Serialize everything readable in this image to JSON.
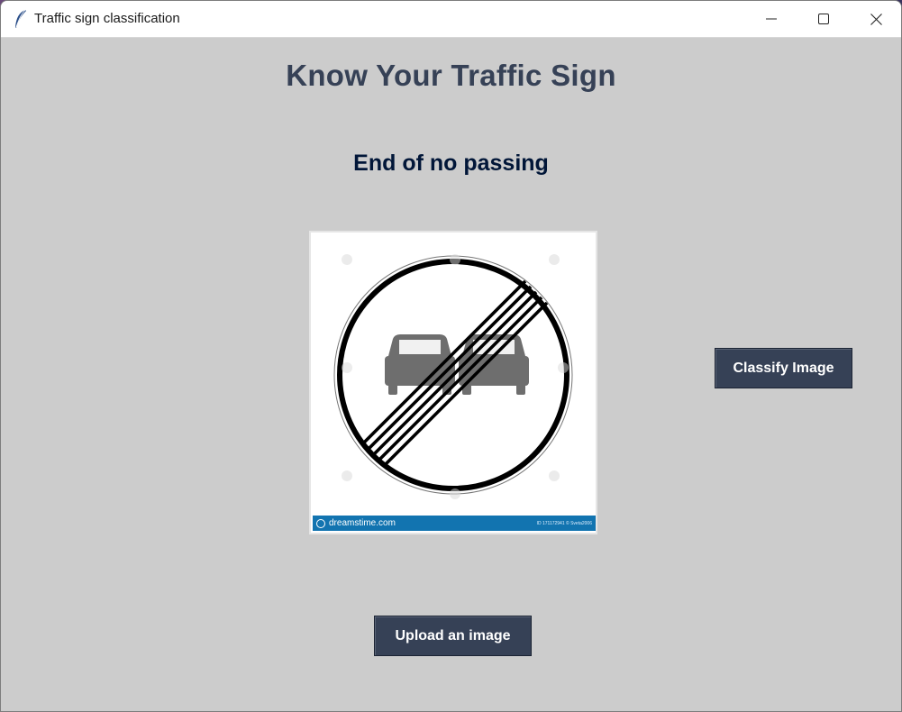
{
  "window": {
    "title": "Traffic sign classification",
    "controls": [
      "minimize-icon",
      "maximize-icon",
      "close-icon"
    ]
  },
  "main": {
    "heading": "Know Your Traffic Sign",
    "result": "End of no passing",
    "image": {
      "subject": "end-of-no-passing-sign",
      "credit": "dreamstime.com",
      "credit_id": "ID 171172941 © Sveta2006"
    },
    "classify_label": "Classify Image",
    "upload_label": "Upload an image"
  },
  "colors": {
    "background": "#cccccc",
    "heading": "#364156",
    "result": "#011638",
    "button_bg": "#364156",
    "button_text": "#ffffff",
    "credit_bar": "#1274b0"
  }
}
